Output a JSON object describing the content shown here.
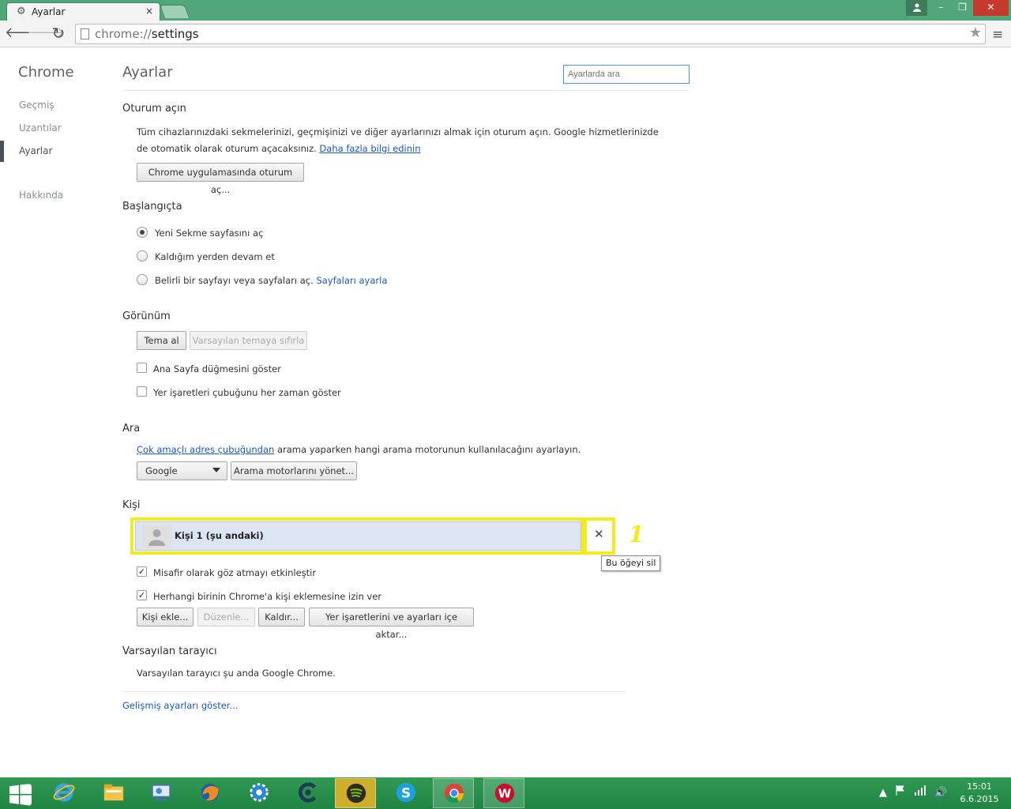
{
  "window": {
    "tab_title": "Ayarlar",
    "tab_close": "×",
    "min_label": "–",
    "max_label": "❐",
    "close_label": "✕"
  },
  "toolbar": {
    "url_scheme": "chrome://",
    "url_path": "settings",
    "back_glyph": "🡐",
    "forward_glyph": "🡒",
    "reload_glyph": "↻",
    "star_glyph": "★",
    "menu_glyph": "≡"
  },
  "nav": {
    "title": "Chrome",
    "items": [
      {
        "label": "Geçmiş"
      },
      {
        "label": "Uzantılar"
      },
      {
        "label": "Ayarlar"
      },
      {
        "label": "Hakkında"
      }
    ]
  },
  "main": {
    "title": "Ayarlar",
    "search_placeholder": "Ayarlarda ara",
    "signin": {
      "heading": "Oturum açın",
      "line1": "Tüm cihazlarınızdaki sekmelerinizi, geçmişinizi ve diğer ayarlarınızı almak için oturum açın. Google hizmetlerinizde",
      "line2": "de otomatik olarak oturum açacaksınız.",
      "more_link": "Daha fazla bilgi edinin",
      "button": "Chrome uygulamasında oturum aç..."
    },
    "startup": {
      "heading": "Başlangıçta",
      "options": [
        {
          "label": "Yeni Sekme sayfasını aç",
          "selected": true
        },
        {
          "label": "Kaldığım yerden devam et",
          "selected": false
        },
        {
          "label": "Belirli bir sayfayı veya sayfaları aç.",
          "selected": false
        }
      ],
      "set_pages_link": "Sayfaları ayarla"
    },
    "appearance": {
      "heading": "Görünüm",
      "get_themes": "Tema al",
      "reset_theme": "Varsayılan temaya sıfırla",
      "show_home": "Ana Sayfa düğmesini göster",
      "show_bookmarks": "Yer işaretleri çubuğunu her zaman göster"
    },
    "search": {
      "heading": "Ara",
      "omnibox_link": "Çok amaçlı adres çubuğundan",
      "description": " arama yaparken hangi arama motorunun kullanılacağını ayarlayın.",
      "engine": "Google",
      "manage_button": "Arama motorlarını yönet..."
    },
    "people": {
      "heading": "Kişi",
      "person_name": "Kişi 1 (şu andaki)",
      "delete_glyph": "✕",
      "tooltip": "Bu öğeyi sil",
      "annotation": "1",
      "guest": "Misafir olarak göz atmayı etkinleştir",
      "guest_checked": true,
      "allow_add": "Herhangi birinin Chrome'a kişi eklemesine izin ver",
      "allow_add_checked": true,
      "add_button": "Kişi ekle...",
      "edit_button": "Düzenle...",
      "remove_button": "Kaldır...",
      "import_button": "Yer işaretlerini ve ayarları içe aktar..."
    },
    "default_browser": {
      "heading": "Varsayılan tarayıcı",
      "text": "Varsayılan tarayıcı şu anda Google Chrome."
    },
    "advanced_link": "Gelişmiş ayarları göster..."
  },
  "taskbar": {
    "icons": [
      "windows-start-icon",
      "internet-explorer-icon",
      "file-explorer-icon",
      "control-panel-icon",
      "firefox-icon",
      "settings-gear-icon",
      "ccleaner-icon",
      "spotify-icon",
      "skype-icon",
      "chrome-icon",
      "wot-icon"
    ],
    "time": "15:01",
    "date": "6.6.2015"
  },
  "colors": {
    "titlebar": "#51a77a",
    "taskbar": "#2a9149",
    "highlight_box": "#f3ec1a",
    "link": "#1a55c2"
  }
}
